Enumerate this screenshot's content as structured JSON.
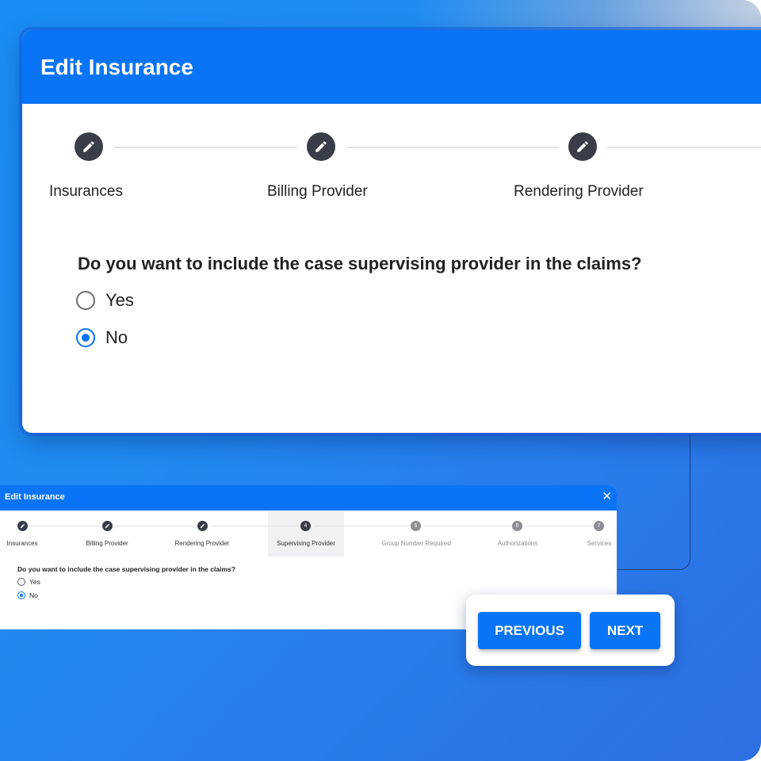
{
  "main_dialog": {
    "title": "Edit Insurance",
    "steps": [
      {
        "label": "Insurances",
        "icon": "pencil-icon",
        "state": "completed"
      },
      {
        "label": "Billing Provider",
        "icon": "pencil-icon",
        "state": "completed"
      },
      {
        "label": "Rendering Provider",
        "icon": "pencil-icon",
        "state": "completed"
      }
    ],
    "question": "Do you want to include the case supervising provider in the claims?",
    "options": [
      {
        "label": "Yes",
        "checked": false
      },
      {
        "label": "No",
        "checked": true
      }
    ]
  },
  "mini_dialog": {
    "title": "Edit Insurance",
    "close_icon": "✕",
    "steps": [
      {
        "label": "Insurances",
        "marker": "",
        "state": "completed"
      },
      {
        "label": "Billing Provider",
        "marker": "",
        "state": "completed"
      },
      {
        "label": "Rendering Provider",
        "marker": "",
        "state": "completed"
      },
      {
        "label": "Supervising Provider",
        "marker": "4",
        "state": "active"
      },
      {
        "label": "Group Number Required",
        "marker": "5",
        "state": "pending"
      },
      {
        "label": "Authorizations",
        "marker": "6",
        "state": "pending"
      },
      {
        "label": "Services",
        "marker": "7",
        "state": "pending"
      }
    ],
    "question": "Do you want to include the case supervising provider in the claims?",
    "options": [
      {
        "label": "Yes",
        "checked": false
      },
      {
        "label": "No",
        "checked": true
      }
    ]
  },
  "actions": {
    "previous_label": "PREVIOUS",
    "next_label": "NEXT"
  },
  "colors": {
    "primary": "#0A74F6",
    "step_completed": "#383D48",
    "step_pending": "#8D8D93",
    "background_start": "#1A8CF5",
    "background_end": "#2F6FE2"
  }
}
